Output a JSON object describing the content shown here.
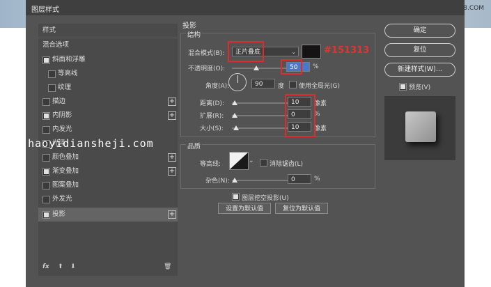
{
  "watermark": "PS教程论坛 WWW.16XX8.COM",
  "window_title": "图层样式",
  "left_panel": {
    "items": [
      {
        "label": "样式",
        "checkbox": null,
        "plus": false,
        "selected": false
      },
      {
        "label": "混合选项",
        "checkbox": null,
        "plus": false,
        "selected": false
      },
      {
        "label": "斜面和浮雕",
        "checkbox": true,
        "plus": false,
        "selected": false
      },
      {
        "label": "等高线",
        "checkbox": false,
        "plus": false,
        "selected": false,
        "indent": true
      },
      {
        "label": "纹理",
        "checkbox": false,
        "plus": false,
        "selected": false,
        "indent": true
      },
      {
        "label": "描边",
        "checkbox": false,
        "plus": true,
        "selected": false
      },
      {
        "label": "内阴影",
        "checkbox": true,
        "plus": true,
        "selected": false
      },
      {
        "label": "内发光",
        "checkbox": false,
        "plus": false,
        "selected": false
      },
      {
        "label": "光泽",
        "checkbox": false,
        "plus": false,
        "selected": false
      },
      {
        "label": "颜色叠加",
        "checkbox": false,
        "plus": true,
        "selected": false
      },
      {
        "label": "渐变叠加",
        "checkbox": true,
        "plus": true,
        "selected": false
      },
      {
        "label": "图案叠加",
        "checkbox": false,
        "plus": false,
        "selected": false
      },
      {
        "label": "外发光",
        "checkbox": false,
        "plus": false,
        "selected": false
      },
      {
        "label": "投影",
        "checkbox": true,
        "plus": true,
        "selected": true
      }
    ],
    "bottom": {
      "fx": "fx",
      "up": "⬆",
      "down": "⬇",
      "trash": "🗑"
    }
  },
  "shadow": {
    "title": "投影",
    "structure": {
      "title": "结构",
      "blend_mode_label": "混合模式(B):",
      "blend_mode_value": "正片叠底",
      "color_annotation": "#151313",
      "opacity_label": "不透明度(O):",
      "opacity_value": "50",
      "opacity_unit": "%",
      "angle_label": "角度(A):",
      "angle_value": "90",
      "angle_unit": "度",
      "global_light_label": "使用全局光(G)",
      "distance_label": "距离(D):",
      "distance_value": "10",
      "distance_unit": "像素",
      "spread_label": "扩展(R):",
      "spread_value": "0",
      "spread_unit": "%",
      "size_label": "大小(S):",
      "size_value": "10",
      "size_unit": "像素"
    },
    "quality": {
      "title": "品质",
      "contour_label": "等高线:",
      "antialias_label": "消除锯齿(L)",
      "noise_label": "杂色(N):",
      "noise_value": "0",
      "noise_unit": "%"
    },
    "knockout_label": "图层挖空投影(U)",
    "set_default": "设置为默认值",
    "reset_default": "复位为默认值"
  },
  "buttons": {
    "ok": "确定",
    "reset": "复位",
    "new_style": "新建样式(W)...",
    "preview_label": "预览(V)"
  },
  "overlay_url": "www.haoyidiansheji.com",
  "colors": {
    "shadow_color": "#151313",
    "annotation": "#e02b2b"
  }
}
